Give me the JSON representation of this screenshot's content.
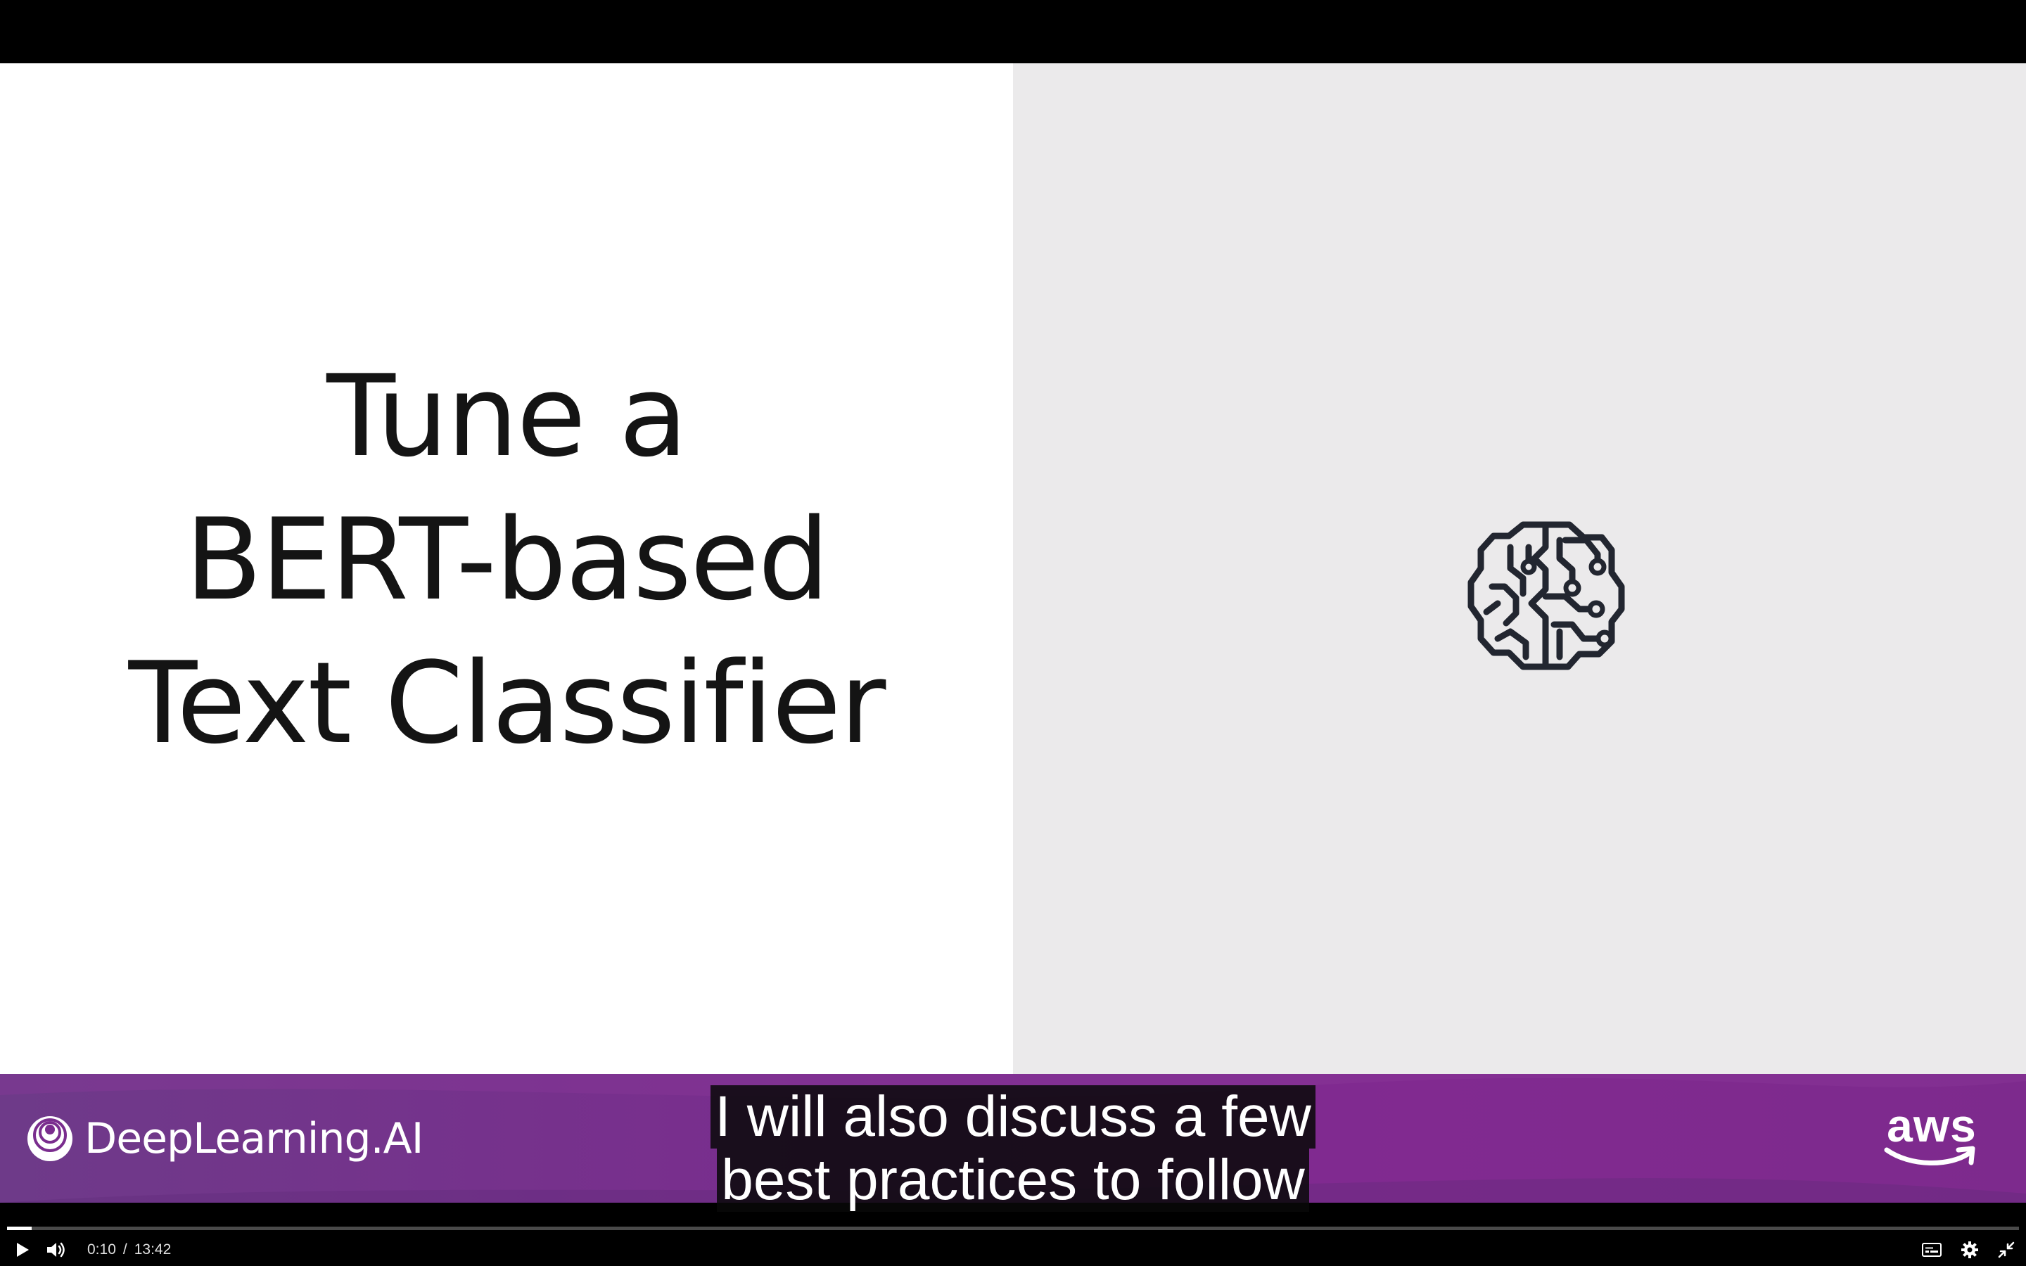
{
  "slide": {
    "title_lines": [
      "Tune a",
      "BERT-based",
      "Text Classifier"
    ],
    "brain_icon": "brain-circuit-icon"
  },
  "footer": {
    "left_logo_text": "DeepLearning.AI",
    "right_logo_text": "aws"
  },
  "captions": {
    "line1": "I will also discuss a few",
    "line2": "best practices to follow"
  },
  "player": {
    "current_time": "0:10",
    "separator": "/",
    "duration": "13:42",
    "progress_fraction": 0.0122,
    "icons": {
      "play": "play-icon",
      "volume": "volume-icon",
      "captions": "captions-icon",
      "settings": "gear-icon",
      "exit_fullscreen": "exit-fullscreen-icon"
    }
  },
  "colors": {
    "footer_purple": "#7a2d8e",
    "slide_right_bg": "#ebeaeb",
    "title_text": "#141414"
  }
}
